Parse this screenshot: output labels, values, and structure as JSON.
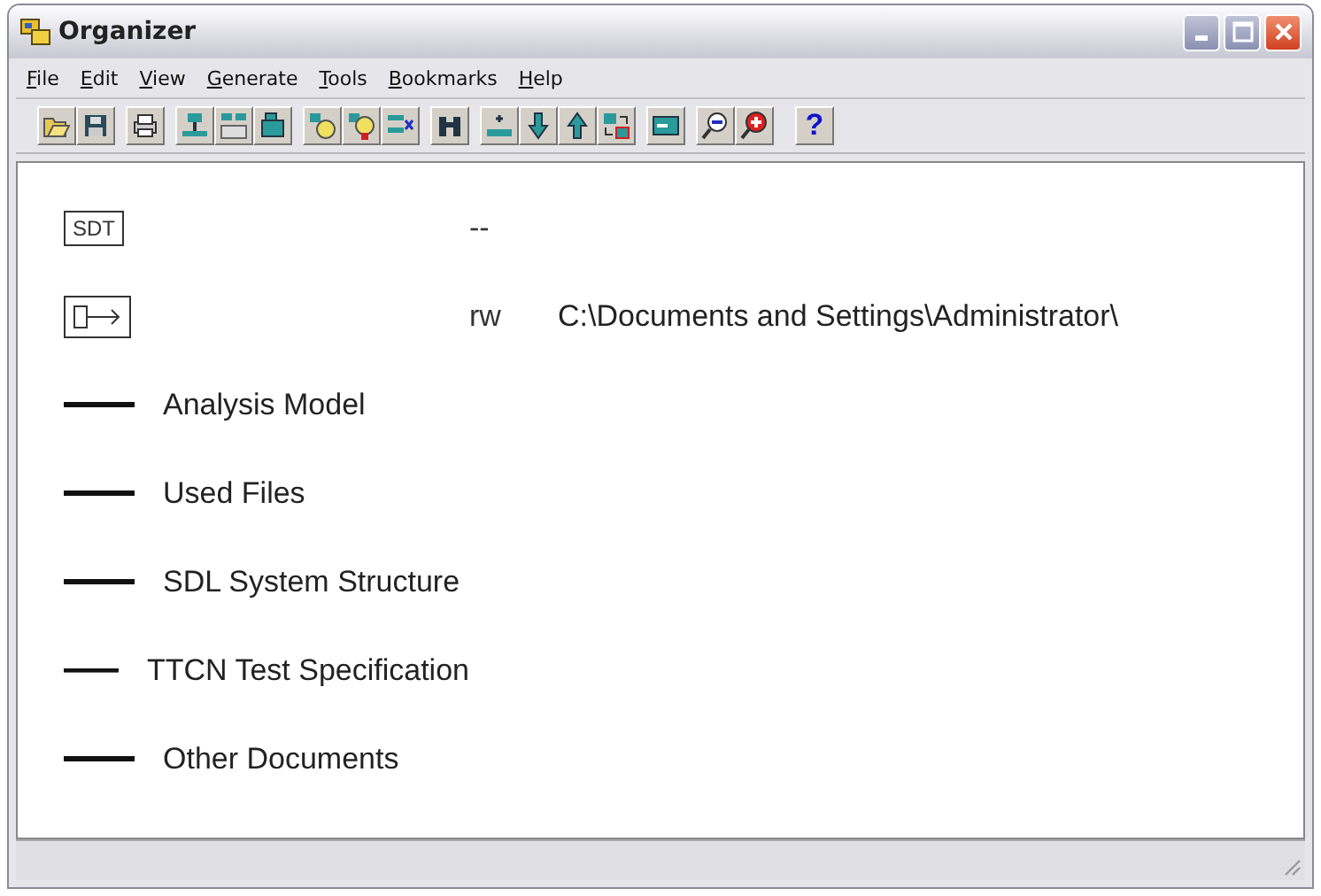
{
  "window": {
    "title": "Organizer"
  },
  "menu": [
    "File",
    "Edit",
    "View",
    "Generate",
    "Tools",
    "Bookmarks",
    "Help"
  ],
  "help_button": {
    "label": "?"
  },
  "items": [
    {
      "kind": "system",
      "label": "SDT",
      "mode": "--"
    },
    {
      "kind": "link",
      "mode": "rw",
      "path": "C:\\Documents and Settings\\Administrator\\"
    },
    {
      "kind": "chapter",
      "label": "Analysis Model"
    },
    {
      "kind": "chapter",
      "label": "Used Files"
    },
    {
      "kind": "chapter",
      "label": "SDL System Structure"
    },
    {
      "kind": "chapter",
      "label": "TTCN Test Specification"
    },
    {
      "kind": "chapter",
      "label": "Other Documents"
    }
  ]
}
